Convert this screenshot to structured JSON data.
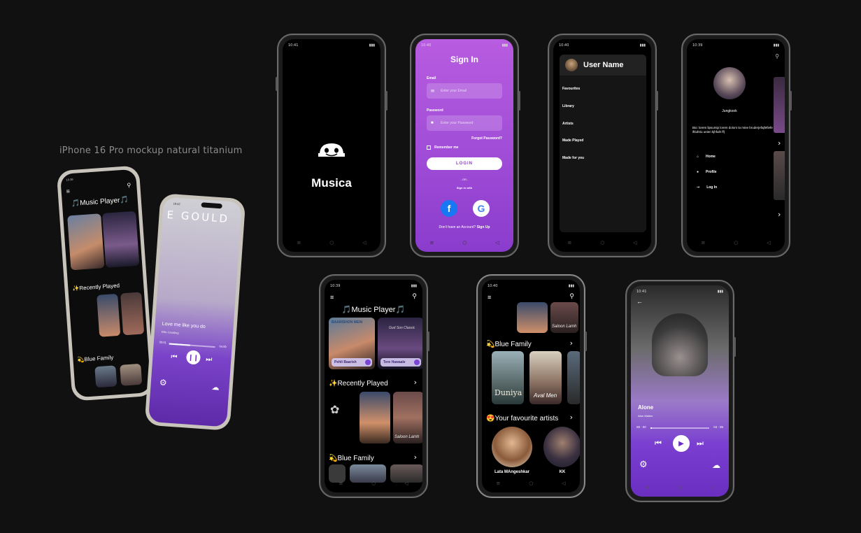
{
  "caption": "iPhone 16 Pro mockup natural titanium",
  "status": {
    "t1": "10:39",
    "t2": "10:41",
    "t3": "10:40",
    "t4": "10:39",
    "t5": "10:39",
    "t6": "10:40",
    "t7": "10:41",
    "t8": "10:42"
  },
  "app": {
    "name": "Musica",
    "home_title": "🎵Music Player🎵"
  },
  "signin": {
    "title": "Sign In",
    "email_label": "Email",
    "email_placeholder": "Enter your Email",
    "password_label": "Password",
    "password_placeholder": "Enter your Password",
    "forgot": "Forgot Password?",
    "remember": "Remember me",
    "login": "LOGIN",
    "or": "- OR -",
    "sign_in_with": "Sign in with",
    "no_account": "Don't have an Account? ",
    "sign_up": "Sign Up"
  },
  "drawer": {
    "user_name": "User Name",
    "items": [
      "Favourites",
      "Library",
      "Artists",
      "Made Played",
      "Made for you"
    ]
  },
  "profile": {
    "name": "Jungkook",
    "bio": "Bio: lorem lipsumip lorem dolors ta mine bruderjefajfefiefe iftiuhriu ueien kjhfuih ff)",
    "items": [
      "Home",
      "Profile",
      "Log In"
    ]
  },
  "home": {
    "card1_title": "Pehli Baarish",
    "card2_title": "Tere Hawaale",
    "card1_art": "BAARISHON MEIN",
    "card2_art": "Gud Son Classic",
    "recent": "✨Recently Played",
    "blue_family": "💫Blue Family",
    "fav_artists": "😍Your favourite artists",
    "art3": "Saloon Lamh",
    "art4": "Duniya",
    "art5": "Aval Men",
    "artist1": "Lata MAngeshkar",
    "artist2": "KK"
  },
  "player1": {
    "song": "Love me like you do",
    "artist": "Ellie Goulding",
    "banner": "E GOULD",
    "elapsed": "00:01",
    "total": "04:09",
    "progress": 0.45
  },
  "player2": {
    "song": "Alone",
    "artist": "Alan Walker",
    "elapsed": "00 : 00",
    "total": "04 : 05",
    "progress": 0.02
  },
  "colors": {
    "accent": "#8a3ccc",
    "bg": "#111111"
  }
}
